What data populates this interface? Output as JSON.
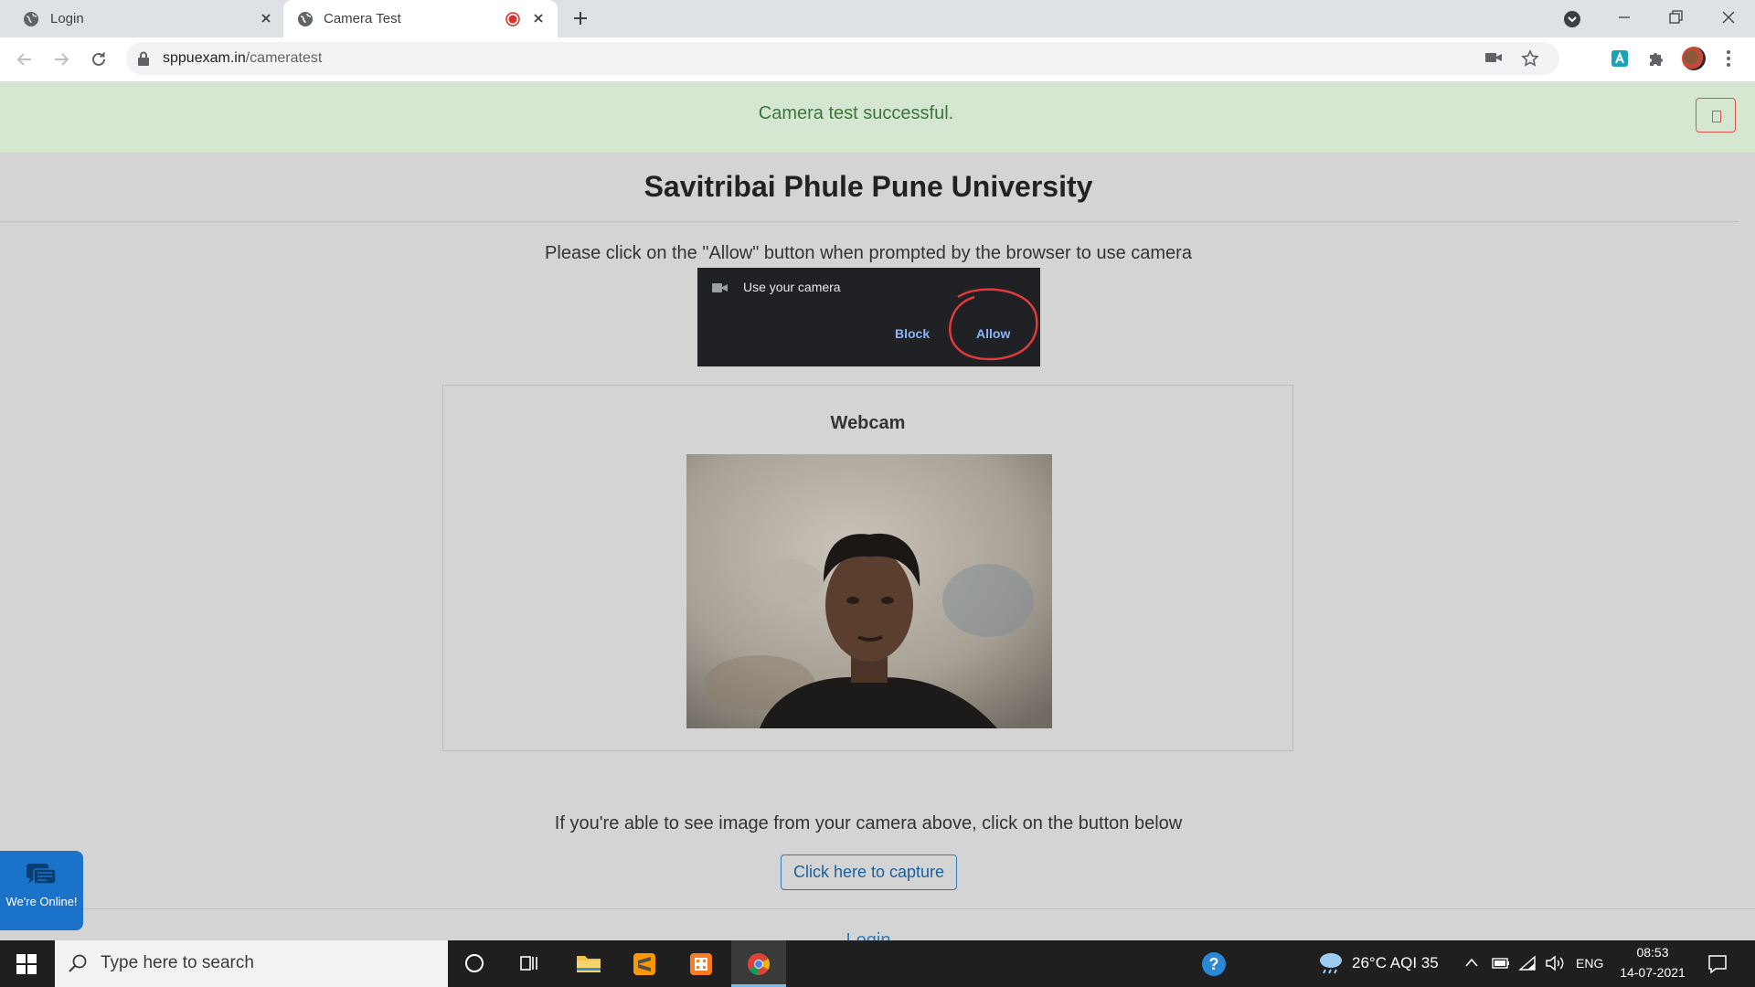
{
  "browser": {
    "tabs": [
      {
        "title": "Login",
        "active": false
      },
      {
        "title": "Camera Test",
        "active": true,
        "recording": true
      }
    ],
    "url_host": "sppuexam.in",
    "url_path": "/cameratest"
  },
  "page": {
    "alert_text": "Camera test successful.",
    "university_title": "Savitribai Phule Pune University",
    "instruction": "Please click on the \"Allow\" button when prompted by the browser to use camera",
    "permission_prompt": {
      "title": "Use your camera",
      "block_label": "Block",
      "allow_label": "Allow"
    },
    "webcam_heading": "Webcam",
    "able_text": "If you're able to see image from your camera above, click on the button below",
    "capture_button": "Click here to capture",
    "login_link": "Login",
    "chat_widget": "We're Online!"
  },
  "taskbar": {
    "search_placeholder": "Type here to search",
    "weather": "26°C AQI 35",
    "language": "ENG",
    "time": "08:53",
    "date": "14-07-2021"
  },
  "colors": {
    "alert_bg": "#d5e7d0",
    "alert_text": "#3c763d",
    "link": "#337ab7",
    "page_bg": "#d4d4d4",
    "chat_bg": "#1a73c8"
  }
}
